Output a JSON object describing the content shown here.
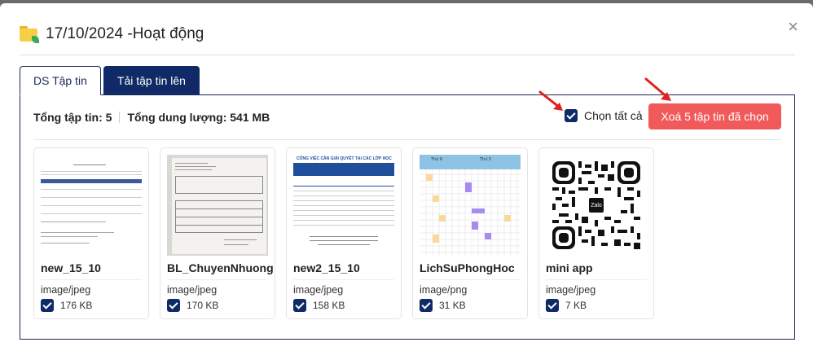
{
  "modal": {
    "title": "17/10/2024 -Hoạt động",
    "close_label": "×"
  },
  "tabs": [
    {
      "label": "DS Tập tin",
      "active": true
    },
    {
      "label": "Tải tập tin lên",
      "active": false
    }
  ],
  "summary": {
    "total_files": "Tổng tập tin: 5",
    "total_size": "Tổng dung lượng: 541 MB"
  },
  "select_all": {
    "label": "Chọn tất cả",
    "checked": true
  },
  "delete_button": {
    "label": "Xoá 5 tập tin đã chọn"
  },
  "colors": {
    "primary": "#0f2a66",
    "danger": "#f15a5a",
    "arrow": "#e02020"
  },
  "files": [
    {
      "name": "new_15_10",
      "type": "image/jpeg",
      "size": "176 KB",
      "checked": true,
      "thumb": "document-scan"
    },
    {
      "name": "BL_ChuyenNhuong",
      "type": "image/jpeg",
      "size": "170 KB",
      "checked": true,
      "thumb": "paper-photo"
    },
    {
      "name": "new2_15_10",
      "type": "image/jpeg",
      "size": "158 KB",
      "checked": true,
      "thumb": "task-list-document"
    },
    {
      "name": "LichSuPhongHoc",
      "type": "image/png",
      "size": "31 KB",
      "checked": true,
      "thumb": "schedule-grid"
    },
    {
      "name": "mini app",
      "type": "image/jpeg",
      "size": "7 KB",
      "checked": true,
      "thumb": "zalo-qr-code"
    }
  ],
  "thumb_texts": {
    "t3_heading": "CÔNG VIỆC CẦN GIẢI QUYẾT TẠI CÁC LỚP HỌC",
    "t4_day1": "Thứ 6",
    "t4_day2": "Thứ 5",
    "qr_label": "Zalo"
  }
}
